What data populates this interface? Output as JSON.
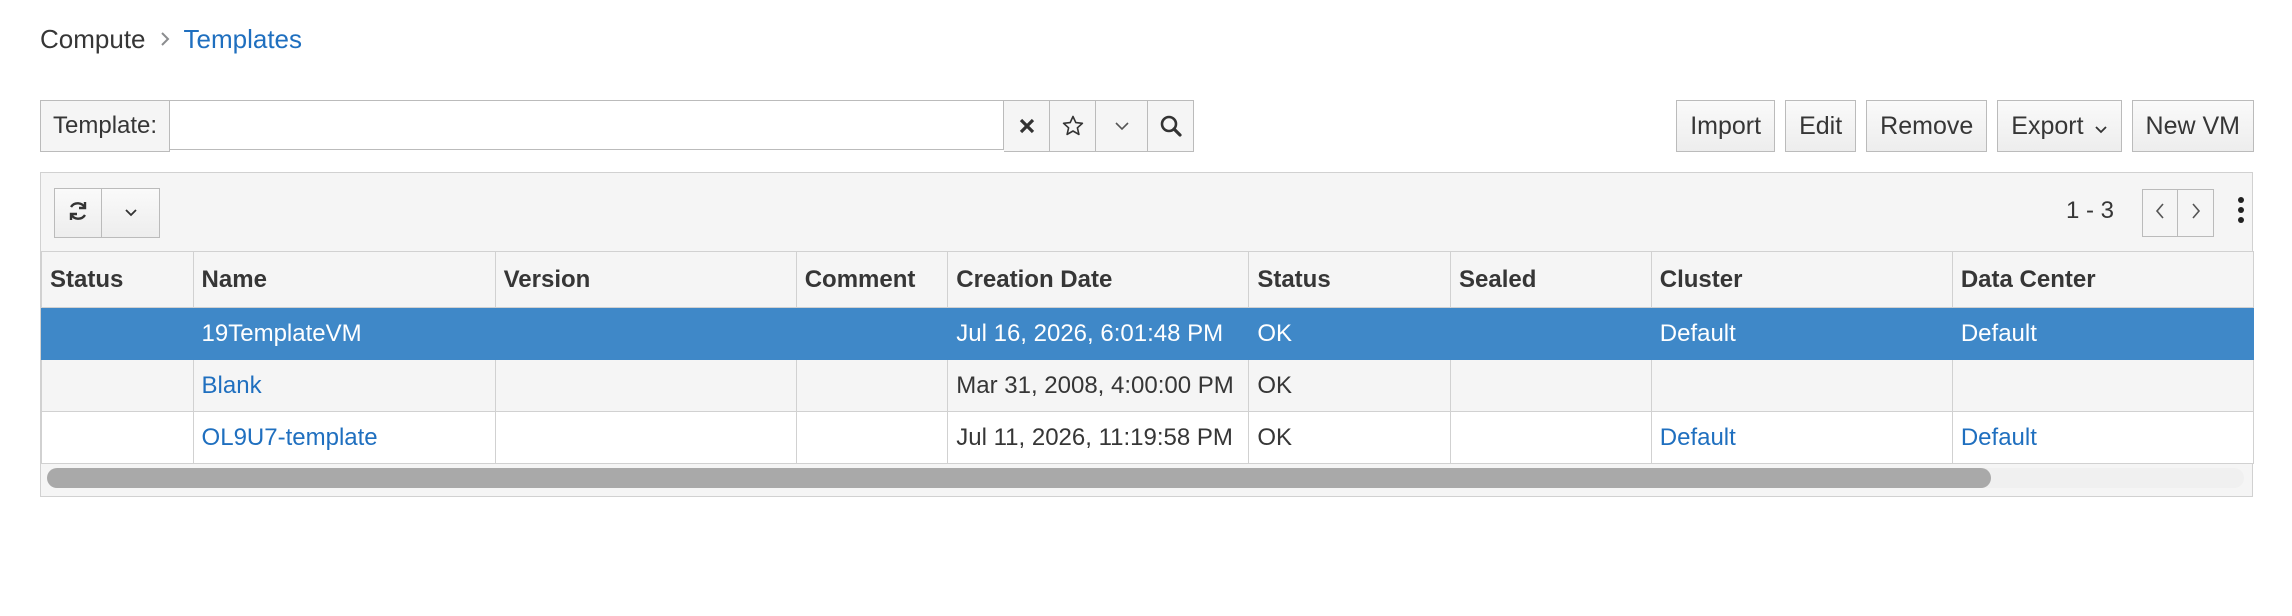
{
  "breadcrumb": {
    "home": "Compute",
    "current": "Templates"
  },
  "search": {
    "label": "Template:",
    "value": "",
    "placeholder": ""
  },
  "actions": {
    "import": "Import",
    "edit": "Edit",
    "remove": "Remove",
    "export": "Export",
    "new_vm": "New VM"
  },
  "pager": {
    "range": "1 - 3"
  },
  "table": {
    "columns": [
      "Status",
      "Name",
      "Version",
      "Comment",
      "Creation Date",
      "Status",
      "Sealed",
      "Cluster",
      "Data Center"
    ],
    "rows": [
      {
        "status": "",
        "name": "19TemplateVM",
        "version": "",
        "comment": "",
        "creation_date": "Jul 16, 2026, 6:01:48 PM",
        "status2": "OK",
        "sealed": "",
        "cluster": "Default",
        "data_center": "Default"
      },
      {
        "status": "",
        "name": "Blank",
        "version": "",
        "comment": "",
        "creation_date": "Mar 31, 2008, 4:00:00 PM",
        "status2": "OK",
        "sealed": "",
        "cluster": "",
        "data_center": ""
      },
      {
        "status": "",
        "name": "OL9U7-template",
        "version": "",
        "comment": "",
        "creation_date": "Jul 11, 2026, 11:19:58 PM",
        "status2": "OK",
        "sealed": "",
        "cluster": "Default",
        "data_center": "Default"
      }
    ]
  },
  "colors": {
    "accent": "#3f88c8",
    "link": "#1f6fbf"
  },
  "icons": [
    "chevron-right-icon",
    "clear-icon",
    "star-icon",
    "chevron-down-icon",
    "search-icon",
    "refresh-icon",
    "prev-page-icon",
    "next-page-icon",
    "kebab-icon"
  ]
}
